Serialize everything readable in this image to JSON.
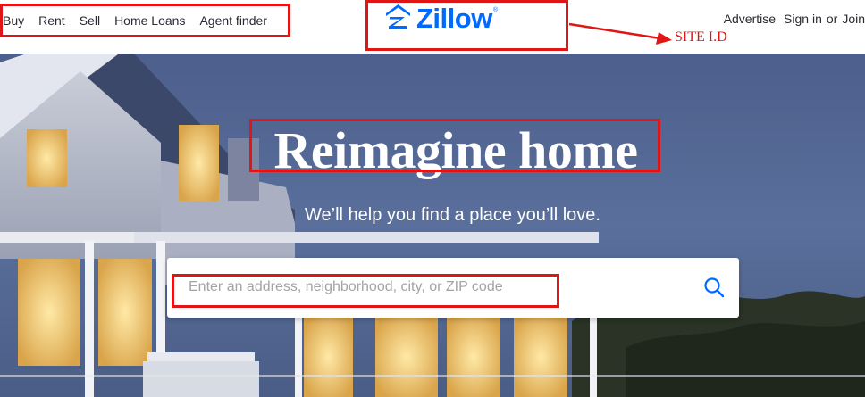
{
  "header": {
    "nav_left": [
      "Buy",
      "Rent",
      "Sell",
      "Home Loans",
      "Agent finder"
    ],
    "logo": {
      "name": "Zillow",
      "registered_mark": "®",
      "icon": "zillow-house-logo-icon",
      "color": "#006aff"
    },
    "nav_right": {
      "advertise": "Advertise",
      "sign_in": "Sign in",
      "or": "or",
      "join": "Join"
    }
  },
  "annotation": {
    "site_id_label": "SITE I.D",
    "color": "#e01515"
  },
  "hero": {
    "title": "Reimagine home",
    "subtitle": "We’ll help you find a place you’ll love.",
    "search": {
      "placeholder": "Enter an address, neighborhood, city, or ZIP code",
      "value": "",
      "icon": "search-icon"
    }
  }
}
